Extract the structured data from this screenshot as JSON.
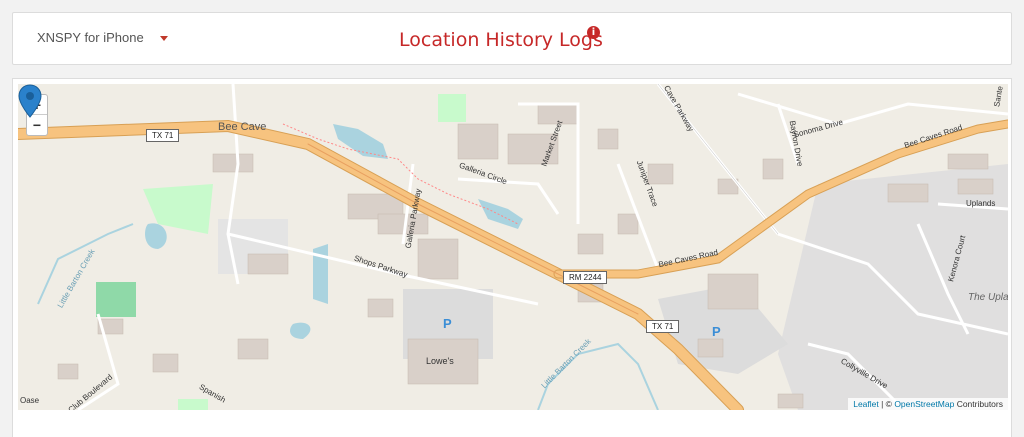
{
  "header": {
    "device_label": "XNSPY for iPhone",
    "title": "Location History Logs",
    "info_icon_glyph": "i"
  },
  "map": {
    "zoom_in": "+",
    "zoom_out": "−",
    "attribution": {
      "leaflet": "Leaflet",
      "sep": " | © ",
      "osm": "OpenStreetMap",
      "contrib": " Contributors"
    },
    "labels": {
      "bee_cave": "Bee Cave",
      "galleria_circle": "Galleria Circle",
      "galleria_parkway": "Galleria Parkway",
      "market_street": "Market Street",
      "juniper_trace": "Juniper Trace",
      "cave_parkway": "Cave Parkway",
      "sonoma_drive": "Sonoma Drive",
      "bayron_drive": "Bayron Drive",
      "bee_caves_road_ne": "Bee Caves Road",
      "bee_caves_road": "Bee Caves Road",
      "shops_parkway": "Shops Parkway",
      "little_barton_creek_w": "Little Barton Creek",
      "little_barton_creek_s": "Little Barton Creek",
      "lowes": "Lowe's",
      "kenora_court": "Kenora Court",
      "uplands": "Uplands",
      "the_uplands": "The Upla",
      "collyville_drive": "Collyville Drive",
      "club_boulevard": "Club Boulevard",
      "spanish": "Spanish",
      "oase": "Oase",
      "santa": "Sante"
    },
    "shields": {
      "tx71_nw": "TX 71",
      "rm2244": "RM 2244",
      "tx71_se": "TX 71"
    },
    "parking": "P",
    "colors": {
      "highway": "#f7c37f",
      "highway_edge": "#d8a055",
      "water": "#aad3df",
      "park": "#c8facc",
      "building": "#d9d0c9",
      "marker": "#2a81cb"
    }
  }
}
